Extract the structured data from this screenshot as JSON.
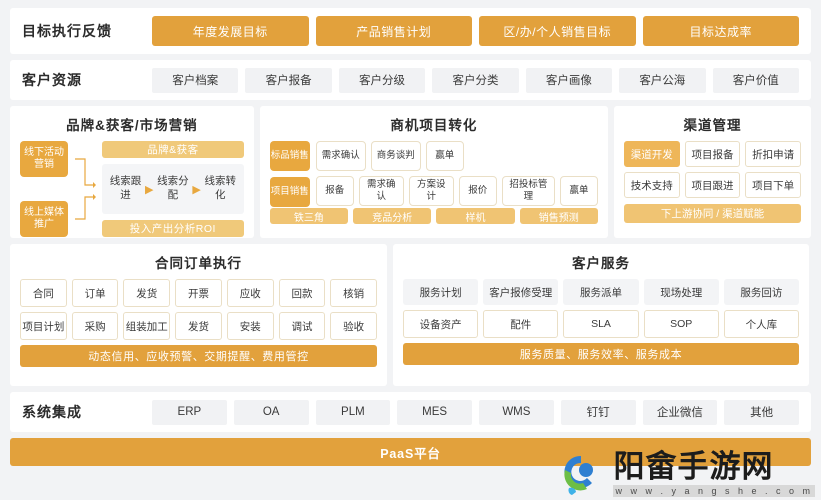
{
  "goal_row": {
    "title": "目标执行反馈",
    "items": [
      "年度发展目标",
      "产品销售计划",
      "区/办/个人销售目标",
      "目标达成率"
    ]
  },
  "customer_row": {
    "title": "客户资源",
    "items": [
      "客户档案",
      "客户报备",
      "客户分级",
      "客户分类",
      "客户画像",
      "客户公海",
      "客户价值"
    ]
  },
  "brand_panel": {
    "title": "品牌&获客/市场营销",
    "sources": [
      "线下活动营销",
      "线上媒体推广"
    ],
    "top_bar": "品牌&获客",
    "flow": [
      "线索跟进",
      "线索分配",
      "线索转化"
    ],
    "bottom_bar": "投入产出分析ROI"
  },
  "opportunity_panel": {
    "title": "商机项目转化",
    "lanes": [
      {
        "label": "标品销售",
        "steps": [
          "需求确认",
          "商务谈判",
          "赢单"
        ]
      },
      {
        "label": "项目销售",
        "steps": [
          "报备",
          "需求确认",
          "方案设计",
          "报价",
          "招投标管理",
          "赢单"
        ]
      }
    ],
    "footer_chips": [
      "铁三角",
      "竞品分析",
      "样机",
      "销售预测"
    ]
  },
  "channel_panel": {
    "title": "渠道管理",
    "cells": [
      "渠道开发",
      "项目报备",
      "折扣申请",
      "技术支持",
      "项目跟进",
      "项目下单"
    ],
    "active_cell": "渠道开发",
    "footer": "下上游协同 / 渠道赋能"
  },
  "contract_panel": {
    "title": "合同订单执行",
    "row1": [
      "合同",
      "订单",
      "发货",
      "开票",
      "应收",
      "回款",
      "核销"
    ],
    "row2": [
      "项目计划",
      "采购",
      "组装加工",
      "发货",
      "安装",
      "调试",
      "验收"
    ],
    "footer": "动态信用、应收预警、交期提醒、费用管控"
  },
  "service_panel": {
    "title": "客户服务",
    "row1": [
      "服务计划",
      "客户报修受理",
      "服务派单",
      "现场处理",
      "服务回访"
    ],
    "row2": [
      "设备资产",
      "配件",
      "SLA",
      "SOP",
      "个人库"
    ],
    "footer": "服务质量、服务效率、服务成本"
  },
  "system_row": {
    "title": "系统集成",
    "items": [
      "ERP",
      "OA",
      "PLM",
      "MES",
      "WMS",
      "钉钉",
      "企业微信",
      "其他"
    ]
  },
  "paas": {
    "label": "PaaS平台"
  },
  "watermark": {
    "name": "阳畲手游网",
    "url": "w w w . y a n g s h e . c o m"
  },
  "colors": {
    "accent": "#e2a13c",
    "accent_light": "#f0c473",
    "gray_chip": "#f1f2f4"
  }
}
